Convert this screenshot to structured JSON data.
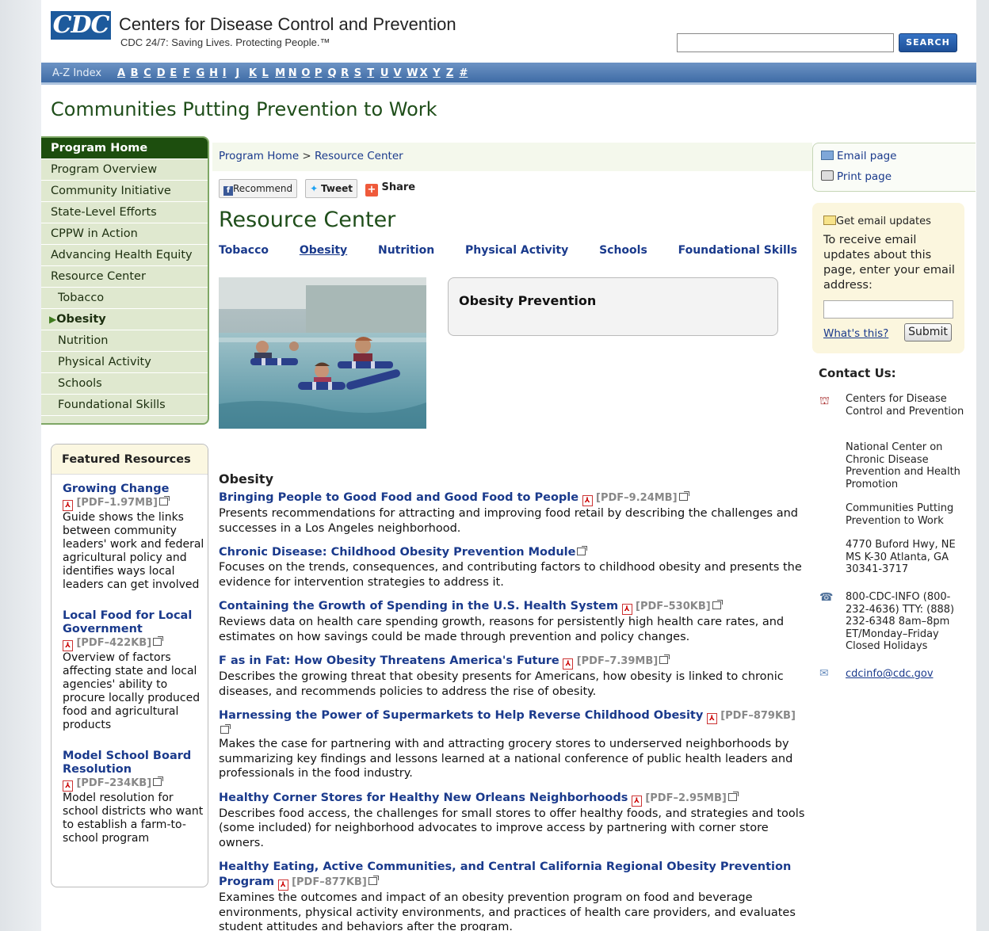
{
  "header": {
    "logo_text": "CDC",
    "org_name": "Centers for Disease Control and Prevention",
    "tagline": "CDC 24/7: Saving Lives. Protecting People.™",
    "search_button": "SEARCH"
  },
  "az": {
    "label": "A-Z Index",
    "letters": [
      "A",
      "B",
      "C",
      "D",
      "E",
      "F",
      "G",
      "H",
      "I",
      "J",
      "K",
      "L",
      "M",
      "N",
      "O",
      "P",
      "Q",
      "R",
      "S",
      "T",
      "U",
      "V",
      "W",
      "X",
      "Y",
      "Z",
      "#"
    ]
  },
  "site_title": "Communities Putting Prevention to Work",
  "leftnav": {
    "home": "Program Home",
    "items": [
      "Program Overview",
      "Community Initiative",
      "State-Level Efforts",
      "CPPW in Action",
      "Advancing Health Equity",
      "Resource Center"
    ],
    "sub": [
      "Tobacco",
      "Obesity",
      "Nutrition",
      "Physical Activity",
      "Schools",
      "Foundational Skills"
    ],
    "active_arrow": "▶"
  },
  "featured": {
    "heading": "Featured Resources",
    "items": [
      {
        "title": "Growing Change",
        "meta": "[PDF–1.97MB]",
        "desc": "Guide shows the links between community leaders' work and federal agricultural policy and identifies ways local leaders can get involved"
      },
      {
        "title": "Local Food for Local Government",
        "meta": "[PDF–422KB]",
        "desc": "Overview of factors affecting state and local agencies' ability to procure locally produced food and agricultural products"
      },
      {
        "title": "Model School Board Resolution",
        "meta": "[PDF–234KB]",
        "desc": "Model resolution for school districts who want to establish a farm-to-school program"
      }
    ]
  },
  "breadcrumb": {
    "home": "Program Home",
    "sep": ">",
    "current": "Resource Center"
  },
  "social": {
    "recommend": "Recommend",
    "tweet": "Tweet",
    "share": "Share"
  },
  "page_heading": "Resource Center",
  "topics": [
    "Tobacco",
    "Obesity",
    "Nutrition",
    "Physical Activity",
    "Schools",
    "Foundational Skills"
  ],
  "feature_box_title": "Obesity Prevention",
  "resources": {
    "heading": "Obesity",
    "items": [
      {
        "title": "Bringing People to Good Food and Good Food to People",
        "meta": "[PDF–9.24MB]",
        "desc": "Presents recommendations for attracting and improving food retail by describing the challenges and successes in a Los Angeles neighborhood."
      },
      {
        "title": "Chronic Disease: Childhood Obesity Prevention Module",
        "meta": "",
        "desc": "Focuses on the trends, consequences, and contributing factors to childhood obesity and presents the evidence for intervention strategies to address it."
      },
      {
        "title": "Containing the Growth of Spending in the U.S. Health System",
        "meta": "[PDF–530KB]",
        "desc": "Reviews data on health care spending growth, reasons for persistently high health care rates, and estimates on how savings could be made through prevention and policy changes."
      },
      {
        "title": "F as in Fat: How Obesity Threatens America's Future",
        "meta": "[PDF–7.39MB]",
        "desc": "Describes the growing threat that obesity presents for Americans, how obesity is linked to chronic diseases, and recommends policies to address the rise of obesity."
      },
      {
        "title": "Harnessing the Power of Supermarkets to Help Reverse Childhood Obesity",
        "meta": "[PDF–879KB]",
        "desc": "Makes the case for partnering with and attracting grocery stores to underserved neighborhoods by summarizing key findings and lessons learned at a national conference of public health leaders and professionals in the food industry."
      },
      {
        "title": "Healthy Corner Stores for Healthy New Orleans Neighborhoods",
        "meta": "[PDF–2.95MB]",
        "desc": "Describes food access, the challenges for small stores to offer healthy foods, and strategies and tools (some included) for neighborhood advocates to improve access by partnering with corner store owners."
      },
      {
        "title": "Healthy Eating, Active Communities, and Central California Regional Obesity Prevention Program",
        "meta": "[PDF–877KB]",
        "desc": "Examines the outcomes and impact of an obesity prevention program on food and beverage environments, physical activity environments, and practices of health care providers, and evaluates student attitudes and behaviors after the program."
      }
    ]
  },
  "util": {
    "email": "Email page",
    "print": "Print page"
  },
  "email_updates": {
    "heading": "Get email updates",
    "text": "To receive email updates about this page, enter your email address:",
    "whats_this": "What's this?",
    "submit": "Submit"
  },
  "contact": {
    "heading": "Contact Us:",
    "org1": "Centers for Disease Control and Prevention",
    "org2": "National Center on Chronic Disease Prevention and Health Promotion",
    "org3": "Communities Putting Prevention to Work",
    "address": "4770 Buford Hwy, NE MS K-30 Atlanta, GA 30341-3717",
    "phone": "800-CDC-INFO (800-232-4636) TTY: (888) 232-6348 8am–8pm ET/Monday–Friday Closed Holidays",
    "email": "cdcinfo@cdc.gov"
  }
}
